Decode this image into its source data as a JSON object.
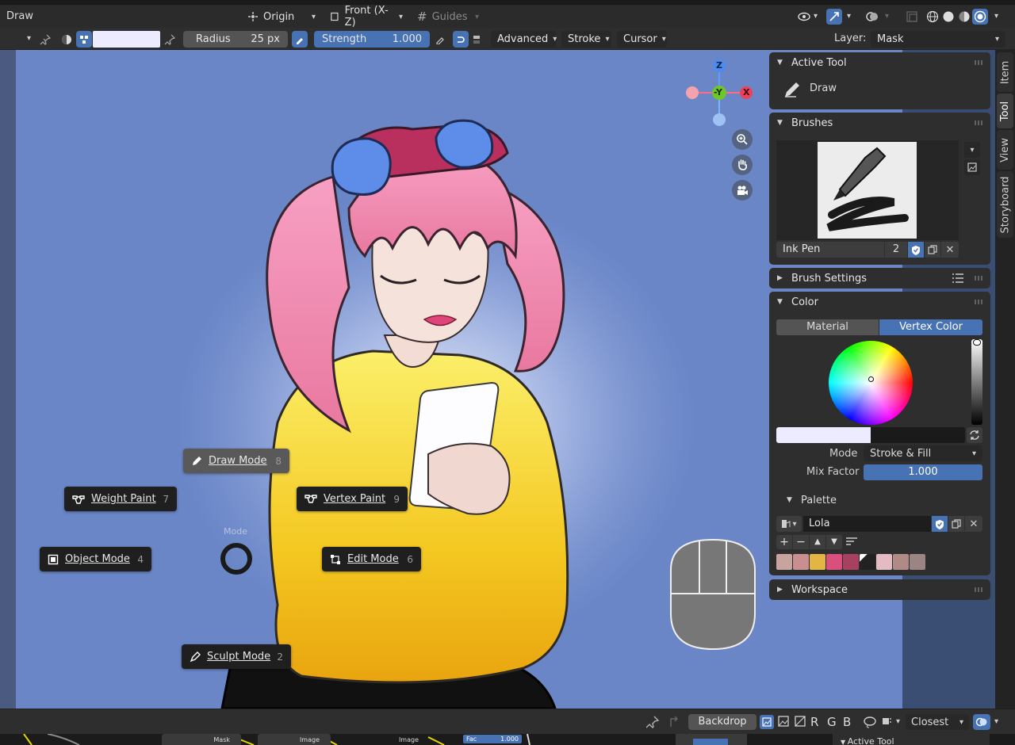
{
  "header": {
    "mode_label": "Draw",
    "origin_label": "Origin",
    "view_label": "Front (X-Z)",
    "guides_label": "Guides"
  },
  "toolbar": {
    "radius_label": "Radius",
    "radius_value": "25 px",
    "strength_label": "Strength",
    "strength_value": "1.000",
    "advanced_label": "Advanced",
    "stroke_label": "Stroke",
    "cursor_label": "Cursor",
    "layer_label": "Layer:",
    "layer_value": "Mask"
  },
  "pie_menu": {
    "title": "Mode",
    "items": [
      {
        "label": "Draw Mode",
        "key": "8"
      },
      {
        "label": "Weight Paint",
        "key": "7"
      },
      {
        "label": "Vertex Paint",
        "key": "9"
      },
      {
        "label": "Object Mode",
        "key": "4"
      },
      {
        "label": "Edit Mode",
        "key": "6"
      },
      {
        "label": "Sculpt Mode",
        "key": "2"
      }
    ]
  },
  "gizmo": {
    "z": "Z",
    "y": "-Y",
    "x": "X"
  },
  "sidebar": {
    "active_tool": {
      "title": "Active Tool",
      "tool_name": "Draw"
    },
    "brushes": {
      "title": "Brushes",
      "brush_name": "Ink Pen",
      "user_count": "2"
    },
    "brush_settings": {
      "title": "Brush Settings"
    },
    "color": {
      "title": "Color",
      "tab_material": "Material",
      "tab_vertex": "Vertex Color",
      "mode_label": "Mode",
      "mode_value": "Stroke & Fill",
      "mix_label": "Mix Factor",
      "mix_value": "1.000"
    },
    "palette": {
      "title": "Palette",
      "name": "Lola",
      "swatches": [
        "#c9a39d",
        "#c98f90",
        "#e2b545",
        "#d9507f",
        "#a8405f",
        "#222222",
        "#e3bcc3",
        "#b08a86",
        "#9a8582"
      ]
    },
    "workspace": {
      "title": "Workspace"
    },
    "tabs": [
      "Item",
      "Tool",
      "View",
      "Storyboard"
    ]
  },
  "bottombar": {
    "backdrop_label": "Backdrop",
    "channels": [
      "R",
      "G",
      "B"
    ],
    "sampling_value": "Closest"
  },
  "nodes": {
    "mask_label": "Mask",
    "image_label_1": "Image",
    "image_label_2": "Image",
    "fac_label": "Fac",
    "fac_value": "1.000",
    "active_tool_label": "Active Tool"
  },
  "colors": {
    "accent": "#4772b3",
    "viewport_bg": "#6a86c7",
    "panel_bg": "#2e2e2e"
  }
}
